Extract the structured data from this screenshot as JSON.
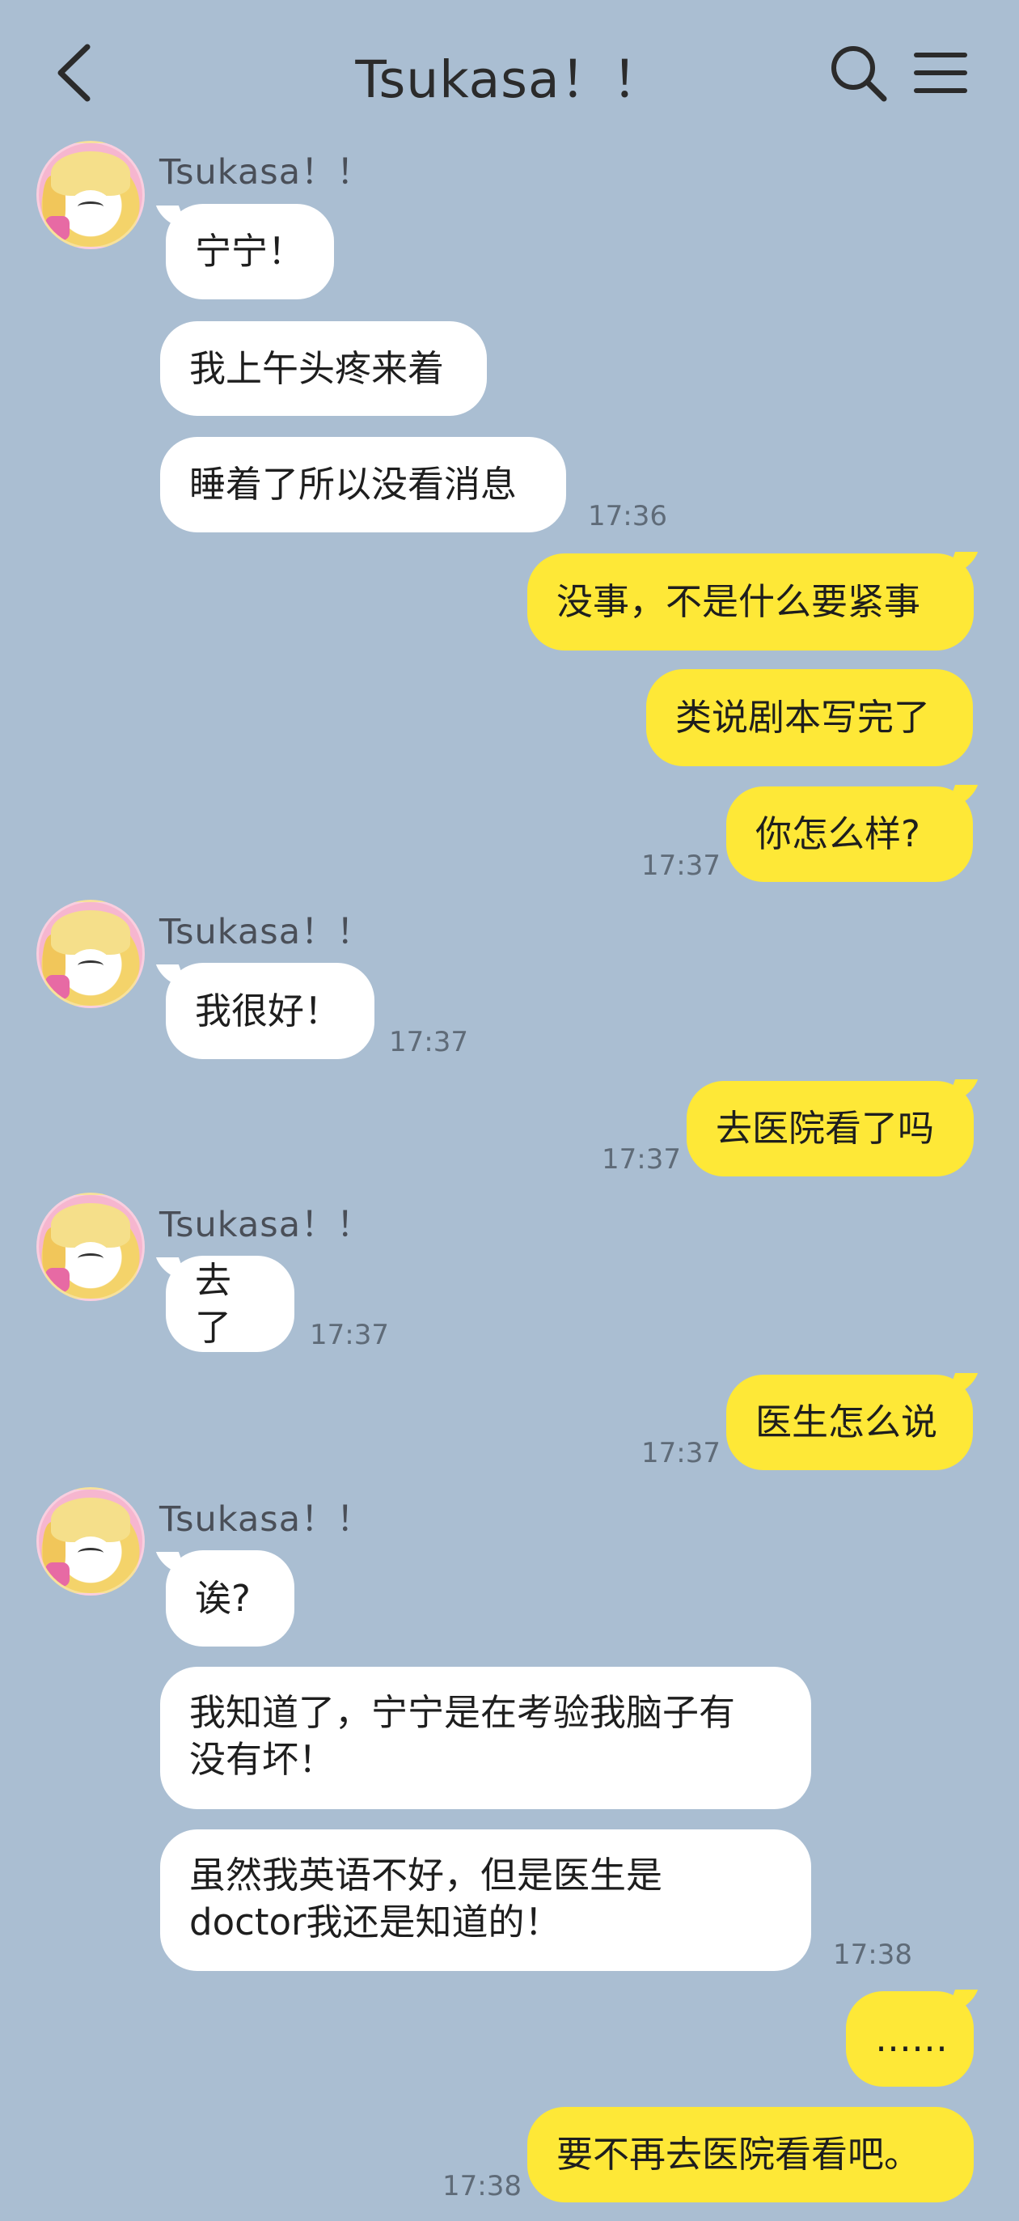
{
  "header": {
    "title": "Tsukasa！！",
    "back_icon": "back-arrow-icon",
    "search_icon": "search-icon",
    "menu_icon": "menu-icon"
  },
  "colors": {
    "background": "#aabed2",
    "incoming_bubble": "#ffffff",
    "outgoing_bubble": "#fee837",
    "timestamp": "#5f6b78"
  },
  "chat": {
    "g1": {
      "sender": "Tsukasa！！",
      "m1": "宁宁！",
      "m2": "我上午头疼来着",
      "m3": "睡着了所以没看消息",
      "time": "17:36"
    },
    "o1": {
      "m1": "没事，不是什么要紧事",
      "m2": "类说剧本写完了",
      "m3": "你怎么样?",
      "time": "17:37"
    },
    "g2": {
      "sender": "Tsukasa！！",
      "m1": "我很好！",
      "time": "17:37"
    },
    "o2": {
      "m1": "去医院看了吗",
      "time": "17:37"
    },
    "g3": {
      "sender": "Tsukasa！！",
      "m1": "去了",
      "time": "17:37"
    },
    "o3": {
      "m1": "医生怎么说",
      "time": "17:37"
    },
    "g4": {
      "sender": "Tsukasa！！",
      "m1": "诶?",
      "m2_line1": "我知道了，宁宁是在考验我脑子有",
      "m2_line2": "没有坏！",
      "m3_line1": "虽然我英语不好，但是医生是",
      "m3_line2": "doctor我还是知道的！",
      "time": "17:38"
    },
    "o4": {
      "m1": "……",
      "m2": "要不再去医院看看吧。",
      "time": "17:38"
    }
  }
}
